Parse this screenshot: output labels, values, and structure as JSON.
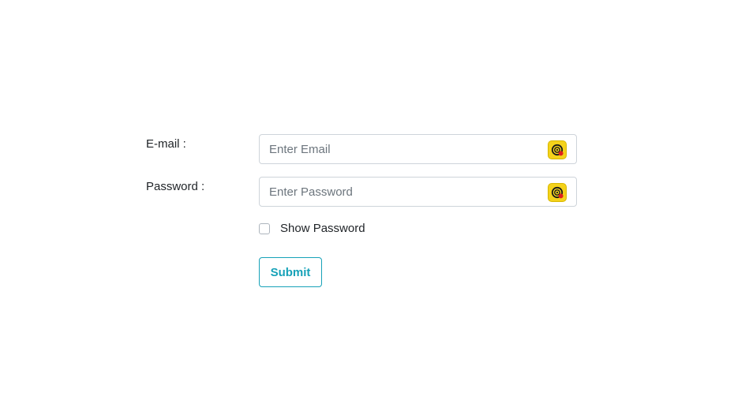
{
  "form": {
    "email": {
      "label": "E-mail :",
      "placeholder": "Enter Email",
      "value": "",
      "icon": "password-manager-extension-icon"
    },
    "password": {
      "label": "Password :",
      "placeholder": "Enter Password",
      "value": "",
      "icon": "password-manager-extension-icon"
    },
    "show_password": {
      "label": "Show Password",
      "checked": false
    },
    "submit_label": "Submit"
  },
  "colors": {
    "accent": "#17a2b8",
    "field_border": "#ced4da",
    "extension_icon_bg": "#f4d21b",
    "extension_icon_dot": "#e0201b"
  }
}
